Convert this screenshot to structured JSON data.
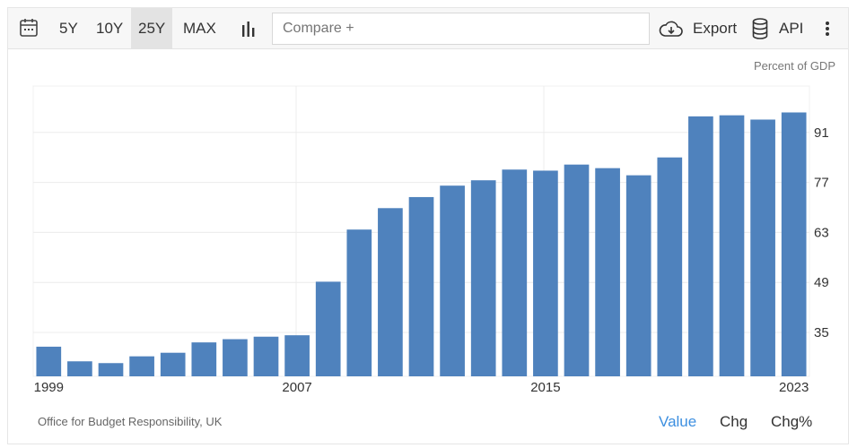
{
  "toolbar": {
    "ranges": [
      "5Y",
      "10Y",
      "25Y",
      "MAX"
    ],
    "active_range": "25Y",
    "compare_placeholder": "Compare +",
    "export_label": "Export",
    "api_label": "API"
  },
  "unit_label": "Percent of GDP",
  "source": "Office for Budget Responsibility, UK",
  "tabs": [
    "Value",
    "Chg",
    "Chg%"
  ],
  "active_tab": "Value",
  "colors": {
    "bar": "#4f82bd",
    "active_tab": "#3d8fe0"
  },
  "chart_data": {
    "type": "bar",
    "title": "",
    "xlabel": "",
    "ylabel": "",
    "grid": true,
    "categories": [
      "1999",
      "2000",
      "2001",
      "2002",
      "2003",
      "2004",
      "2005",
      "2006",
      "2007",
      "2008",
      "2009",
      "2010",
      "2011",
      "2012",
      "2013",
      "2014",
      "2015",
      "2016",
      "2017",
      "2018",
      "2019",
      "2020",
      "2021",
      "2022",
      "2023"
    ],
    "values": [
      31.0,
      26.9,
      26.4,
      28.3,
      29.3,
      32.2,
      33.1,
      33.8,
      34.2,
      49.2,
      63.8,
      69.8,
      72.9,
      76.1,
      77.6,
      80.6,
      80.3,
      82.0,
      81.0,
      79.0,
      84.0,
      95.5,
      95.8,
      94.6,
      96.6
    ],
    "y_ticks": [
      35,
      49,
      63,
      77,
      91
    ],
    "x_tick_labels": [
      "1999",
      "2007",
      "2015",
      "2023"
    ],
    "ylim": [
      22.7,
      104.0
    ]
  }
}
